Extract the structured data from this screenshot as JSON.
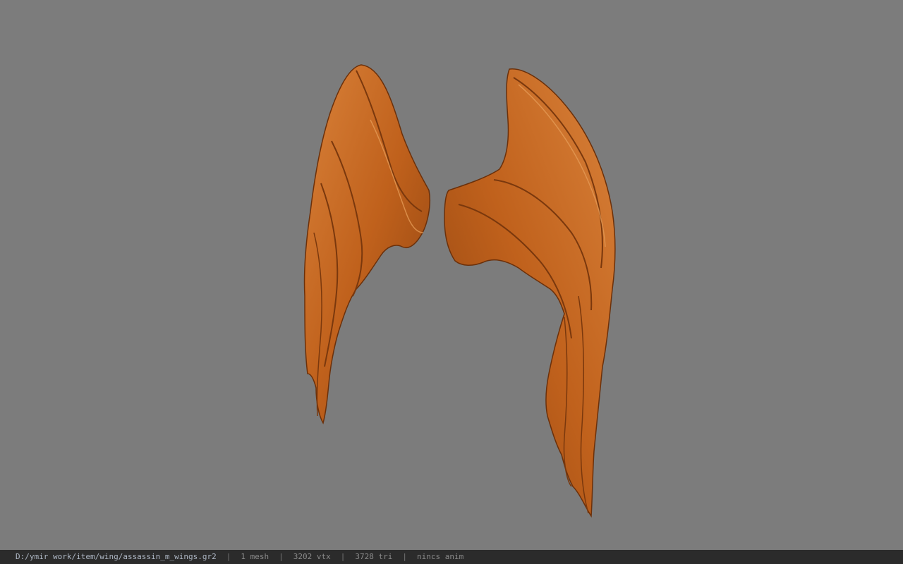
{
  "viewer": {
    "background_color": "#7c7c7c",
    "model_color": "#c9671d",
    "model": "wings"
  },
  "status": {
    "file_path": "D:/ymir work/item/wing/assassin_m_wings.gr2",
    "separator": "|",
    "meshes": "1 mesh",
    "vertices": "3202 vtx",
    "triangles": "3728 tri",
    "anim": "nincs anim"
  }
}
